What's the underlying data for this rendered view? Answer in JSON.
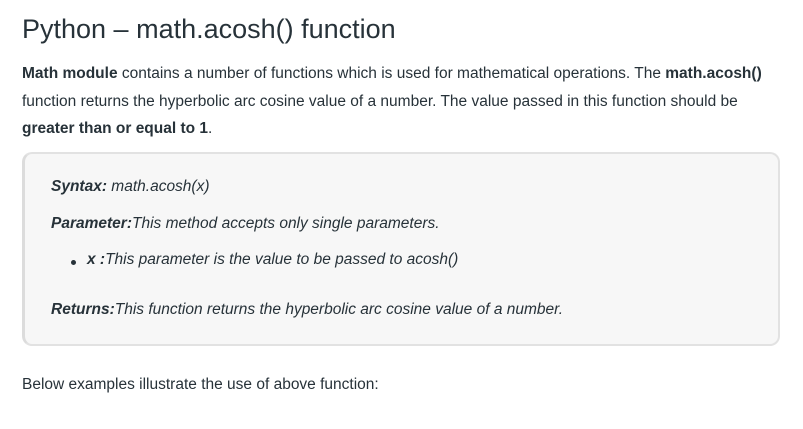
{
  "title": "Python – math.acosh() function",
  "intro": {
    "part1_bold": "Math module",
    "part2": " contains a number of functions which is used for mathematical operations. The ",
    "part3_bold": "math.acosh()",
    "part4": " function returns the hyperbolic arc cosine value of a number. The value passed in this function should be ",
    "part5_bold": "greater than or equal to 1",
    "part6": "."
  },
  "syntax": {
    "label": "Syntax:",
    "value": " math.acosh(x)"
  },
  "parameter": {
    "label": "Parameter:",
    "value": "This method accepts only single parameters."
  },
  "param_x": {
    "label": "x :",
    "value": "This parameter is the value to be passed to acosh()"
  },
  "returns": {
    "label": "Returns:",
    "value": "This function returns the hyperbolic arc cosine value of a number."
  },
  "outro": "Below examples illustrate the use of above function:"
}
